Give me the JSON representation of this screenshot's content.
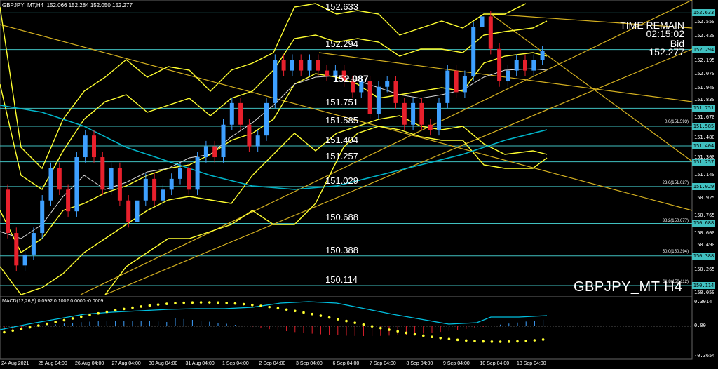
{
  "header": {
    "symbol_info": "GBPJPY_MT,H4  152.066 152.284 152.050 152.277"
  },
  "overlay": {
    "time_remain_label": "TIME REMAIN",
    "time_remain_value": "02:15:02",
    "bid_label": "Bid",
    "bid_value": "152.277",
    "symbol_timeframe": "GBPJPY_MT H4",
    "current_marker": "152.087"
  },
  "levels": [
    {
      "label": "152.633",
      "line": "152.633",
      "color": "#40c0c0"
    },
    {
      "label": "152.294",
      "line": "152.294",
      "color": "#40c0c0"
    },
    {
      "label": "151.751",
      "line": "151.751",
      "color": "#40c0c0"
    },
    {
      "label": "151.585",
      "line": "151.585",
      "color": "#40c0c0"
    },
    {
      "label": "151.404",
      "line": "151.404",
      "color": "#40c0c0"
    },
    {
      "label": "151.257",
      "line": "151.257",
      "color": "#40c0c0"
    },
    {
      "label": "151.029",
      "line": "151.029",
      "color": "#40c0c0"
    },
    {
      "label": "150.688",
      "line": "150.688",
      "color": "#40c0c0"
    },
    {
      "label": "150.388",
      "line": "150.388",
      "color": "#40c0c0"
    },
    {
      "label": "150.114",
      "line": "150.114",
      "color": "#40c0c0"
    }
  ],
  "fibonacci": [
    "0.0(151.593)",
    "23.6(151.027)",
    "38.2(150.677)",
    "50.0(150.394)",
    "61.8(150.112)"
  ],
  "price_axis": [
    "152.633",
    "152.550",
    "152.420",
    "152.294",
    "152.195",
    "152.070",
    "151.940",
    "151.830",
    "151.751",
    "151.670",
    "151.585",
    "151.480",
    "151.404",
    "151.300",
    "151.257",
    "151.140",
    "151.029",
    "150.925",
    "150.765",
    "150.688",
    "150.600",
    "150.490",
    "150.388",
    "150.265",
    "150.114",
    "150.050"
  ],
  "macd": {
    "info": "MACD(12,26,9) 0.0992 0.1002 0.0000 -0.0009",
    "axis": [
      "0.3014",
      "0.00",
      "-0.3654"
    ]
  },
  "dates": [
    "24 Aug 2021",
    "25 Aug 04:00",
    "26 Aug 04:00",
    "27 Aug 04:00",
    "30 Aug 04:00",
    "31 Aug 04:00",
    "1 Sep 04:00",
    "2 Sep 04:00",
    "3 Sep 04:00",
    "6 Sep 04:00",
    "7 Sep 04:00",
    "8 Sep 04:00",
    "9 Sep 04:00",
    "10 Sep 04:00",
    "13 Sep 04:00"
  ],
  "colors": {
    "bull": "#3ea0ff",
    "bear": "#e8202c",
    "bands": "#ffff30",
    "trendline": "#d4b020",
    "ma": "#00b4c8",
    "level_line": "#40c0c0"
  }
}
